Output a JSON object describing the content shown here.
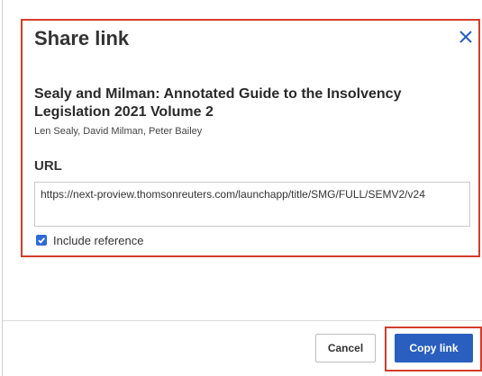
{
  "dialog": {
    "title": "Share link",
    "close_icon": "close-icon"
  },
  "book": {
    "title": "Sealy and Milman: Annotated Guide to the Insolvency Legislation 2021 Volume 2",
    "authors": "Len Sealy, David Milman, Peter Bailey"
  },
  "url": {
    "label": "URL",
    "value": "https://next-proview.thomsonreuters.com/launchapp/title/SMG/FULL/SEMV2/v24"
  },
  "include_reference": {
    "label": "Include reference",
    "checked": true
  },
  "buttons": {
    "cancel": "Cancel",
    "copy": "Copy link"
  },
  "colors": {
    "accent": "#2a5fbf",
    "highlight": "#d43d2a",
    "checkbox": "#2d6cd6"
  }
}
